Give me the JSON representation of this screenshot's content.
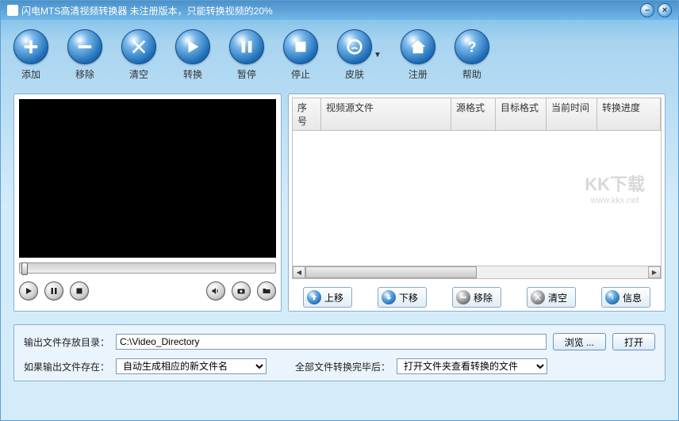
{
  "titlebar": {
    "title": "闪电MTS高清视频转换器   未注册版本，只能转换视频的20%"
  },
  "toolbar": {
    "add": "添加",
    "remove": "移除",
    "clear": "清空",
    "convert": "转换",
    "pause": "暂停",
    "stop": "停止",
    "skin": "皮肤",
    "register": "注册",
    "help": "帮助"
  },
  "table": {
    "headers": {
      "index": "序号",
      "source": "视频源文件",
      "srcformat": "源格式",
      "dstformat": "目标格式",
      "curtime": "当前时间",
      "progress": "转换进度"
    },
    "watermark": "KK下载",
    "watermark_sub": "www.kkx.net"
  },
  "actions": {
    "up": "上移",
    "down": "下移",
    "remove": "移除",
    "clear": "清空",
    "info": "信息"
  },
  "bottom": {
    "output_dir_label": "输出文件存放目录：",
    "output_dir_value": "C:\\Video_Directory",
    "browse": "浏览 ...",
    "open": "打开",
    "exists_label": "如果输出文件存在：",
    "exists_value": "自动生成相应的新文件名",
    "after_label": "全部文件转换完毕后：",
    "after_value": "打开文件夹查看转换的文件"
  }
}
